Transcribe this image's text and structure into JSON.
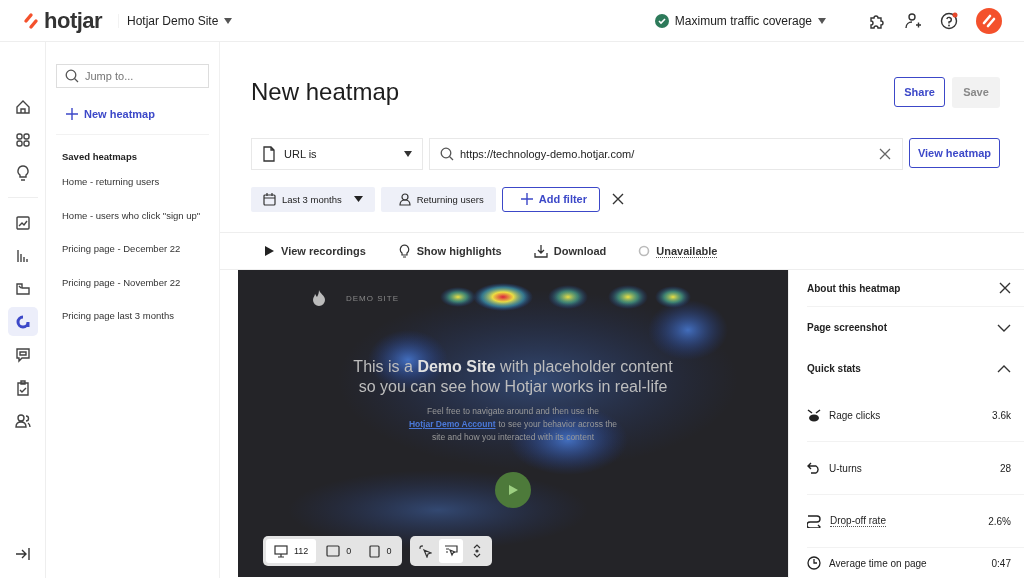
{
  "topbar": {
    "logo": "hotjar",
    "site": "Hotjar Demo Site",
    "coverage": "Maximum traffic coverage",
    "help_badge": true
  },
  "nav": [
    {
      "selected": false
    },
    {
      "selected": false
    },
    {
      "selected": false
    },
    {
      "selected": false
    },
    {
      "selected": false
    },
    {
      "selected": false
    },
    {
      "selected": true
    },
    {
      "selected": false
    },
    {
      "selected": false
    },
    {
      "selected": false
    }
  ],
  "sidebar": {
    "search": {
      "placeholder": "Jump to..."
    },
    "new_button": "New heatmap",
    "section_title": "Saved heatmaps",
    "items": [
      {
        "label": "Home - returning users",
        "selected": false
      },
      {
        "label": "Home - users who click \"sign up\"",
        "selected": false
      },
      {
        "label": "Pricing page - December 22",
        "selected": false
      },
      {
        "label": "Pricing page - November 22",
        "selected": false
      },
      {
        "label": "Pricing page last 3 months",
        "selected": false
      }
    ]
  },
  "page": {
    "title": "New heatmap",
    "share": "Share",
    "save": "Save",
    "save_disabled": true
  },
  "filters": {
    "url_rule": "URL is",
    "url": "https://technology-demo.hotjar.com/",
    "view_button": "View heatmap",
    "date": "Last 3 months",
    "segment": "Returning users",
    "add_filter": "Add filter"
  },
  "toolbar": [
    {
      "kind": "play",
      "label": "View recordings"
    },
    {
      "kind": "bulb",
      "label": "Show highlights"
    },
    {
      "kind": "download",
      "label": "Download"
    },
    {
      "kind": "status",
      "label": "Unavailable"
    }
  ],
  "heatmap": {
    "brand": "DEMO SITE",
    "headline": "This is a **Demo Site** with placeholder content",
    "headline_2": "so you can see how Hotjar works in real-life",
    "text_1": "Feel free to navigate around and then use the",
    "link": "Hotjar Demo Account",
    "text_2": "to see your behavior across the",
    "text_3": "site and how you interacted with its content",
    "devices": [
      {
        "kind": "desktop",
        "count": "112",
        "selected": true
      },
      {
        "kind": "tablet",
        "count": "0",
        "selected": false
      },
      {
        "kind": "mobile",
        "count": "0",
        "selected": false
      }
    ],
    "tools": [
      {
        "kind": "click",
        "selected": false
      },
      {
        "kind": "move",
        "selected": true
      },
      {
        "kind": "scroll",
        "selected": false
      }
    ]
  },
  "panel": {
    "title": "About this heatmap",
    "sections": [
      {
        "title": "Page screenshot",
        "expanded": false
      },
      {
        "title": "Quick stats",
        "expanded": true
      }
    ],
    "stats": [
      {
        "kind": "rage",
        "label": "Rage clicks",
        "value": "3.6k",
        "dotted_underline": false
      },
      {
        "kind": "uturn",
        "label": "U-turns",
        "value": "28",
        "dotted_underline": false
      },
      {
        "kind": "dropoff",
        "label": "Drop-off rate",
        "value": "2.6%",
        "dotted_underline": true
      },
      {
        "kind": "time",
        "label": "Average time on page",
        "value": "0:47",
        "dotted_underline": false
      }
    ]
  }
}
